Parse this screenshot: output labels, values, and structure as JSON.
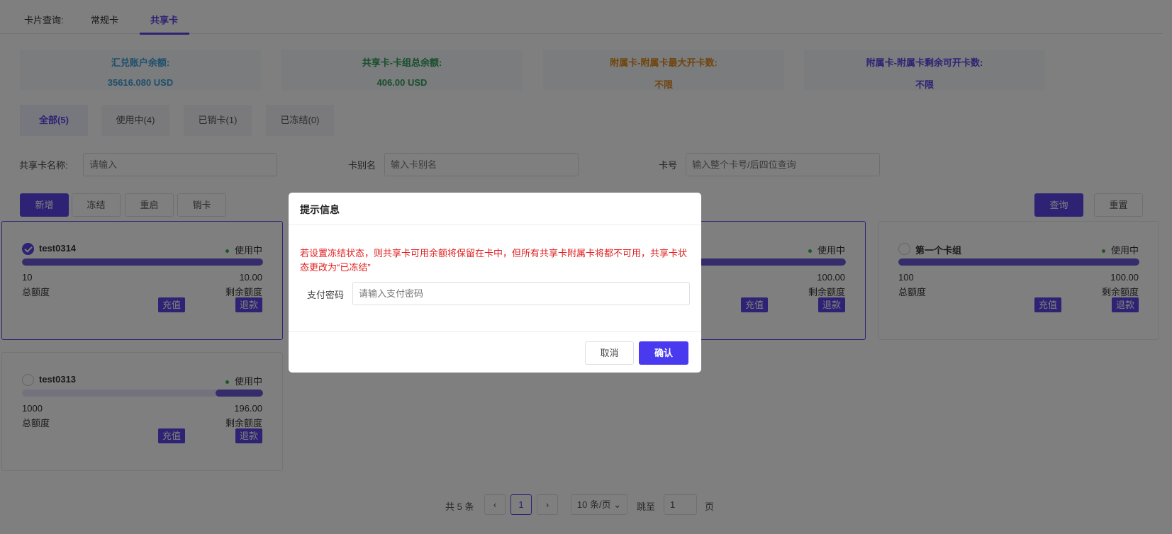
{
  "tabs": {
    "label": "卡片查询:",
    "items": [
      "常规卡",
      "共享卡"
    ],
    "active": "共享卡"
  },
  "stats": [
    {
      "label": "汇兑账户余额:",
      "value": "35616.080 USD"
    },
    {
      "label": "共享卡-卡组总余额:",
      "value": "406.00 USD"
    },
    {
      "label": "附属卡-附属卡最大开卡数:",
      "value": "不限"
    },
    {
      "label": "附属卡-附属卡剩余可开卡数:",
      "value": "不限"
    }
  ],
  "filter_tabs": [
    "全部(5)",
    "使用中(4)",
    "已销卡(1)",
    "已冻结(0)"
  ],
  "search": {
    "name_label": "共享卡名称:",
    "name_placeholder": "请输入",
    "alias_label": "卡别名",
    "alias_placeholder": "输入卡别名",
    "number_label": "卡号",
    "number_placeholder": "输入整个卡号/后四位查询"
  },
  "actions": {
    "add": "新增",
    "freeze": "冻结",
    "restart": "重启",
    "cancel_card": "销卡",
    "query": "查询",
    "reset": "重置"
  },
  "cards": [
    {
      "name": "test0314",
      "status": "使用中",
      "total": "10",
      "total_label": "总额度",
      "remaining": "10.00",
      "remaining_label": "剩余额度",
      "remaining_ratio": 1.0,
      "recharge": "充值",
      "refund": "退款",
      "selected": true
    },
    {
      "name": "",
      "status": "使用中",
      "total": "",
      "total_label": "",
      "remaining": "100.00",
      "remaining_label": "剩余额度",
      "remaining_ratio": 1.0,
      "recharge": "充值",
      "refund": "退款",
      "selected": false
    },
    {
      "name": "第一个卡组",
      "status": "使用中",
      "total": "100",
      "total_label": "总额度",
      "remaining": "100.00",
      "remaining_label": "剩余额度",
      "remaining_ratio": 1.0,
      "recharge": "充值",
      "refund": "退款",
      "selected": false
    },
    {
      "name": "test0313",
      "status": "使用中",
      "total": "1000",
      "total_label": "总额度",
      "remaining": "196.00",
      "remaining_label": "剩余额度",
      "remaining_ratio": 0.196,
      "recharge": "充值",
      "refund": "退款",
      "selected": false
    }
  ],
  "pagination": {
    "total": "共 5 条",
    "prev": "‹",
    "page": "1",
    "next": "›",
    "page_size": "10 条/页",
    "jump_label": "跳至",
    "jump_value": "1",
    "page_unit": "页"
  },
  "dialog": {
    "title": "提示信息",
    "warning": "若设置冻结状态，则共享卡可用余额将保留在卡中，但所有共享卡附属卡将都不可用，共享卡状态更改为“已冻结”",
    "password_label": "支付密码",
    "password_placeholder": "请输入支付密码",
    "cancel": "取消",
    "confirm": "确认"
  },
  "colors": {
    "accent": "#5a45e8",
    "warning": "#e02020",
    "active_dot": "#3cb043"
  }
}
